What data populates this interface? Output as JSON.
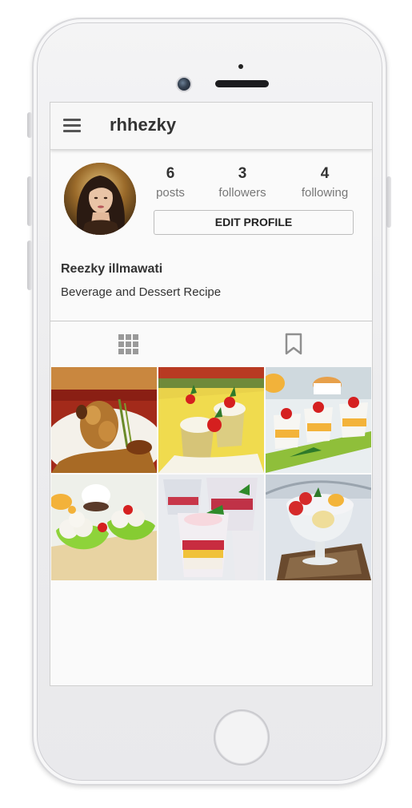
{
  "app": {
    "username": "rhhezky"
  },
  "profile": {
    "full_name": "Reezky illmawati",
    "bio": "Beverage and Dessert Recipe",
    "edit_label": "EDIT PROFILE"
  },
  "stats": [
    {
      "value": "6",
      "label": "posts"
    },
    {
      "value": "3",
      "label": "followers"
    },
    {
      "value": "4",
      "label": "following"
    }
  ],
  "tabs": [
    {
      "icon": "grid-icon",
      "active": true
    },
    {
      "icon": "bookmark-icon",
      "active": false
    }
  ],
  "posts": [
    {
      "subject": "glazed fried bananas with caramel sauce"
    },
    {
      "subject": "coconut puddings with cherries on yellow plate"
    },
    {
      "subject": "white puddings with mango and fruit"
    },
    {
      "subject": "coconut ice cream in green cups"
    },
    {
      "subject": "layered ice desserts in glasses"
    },
    {
      "subject": "shaved ice dessert with strawberries"
    }
  ],
  "colors": {
    "screen_bg": "#fafafa",
    "text": "#333333",
    "muted": "#777777",
    "icon": "#9a9a9a"
  }
}
